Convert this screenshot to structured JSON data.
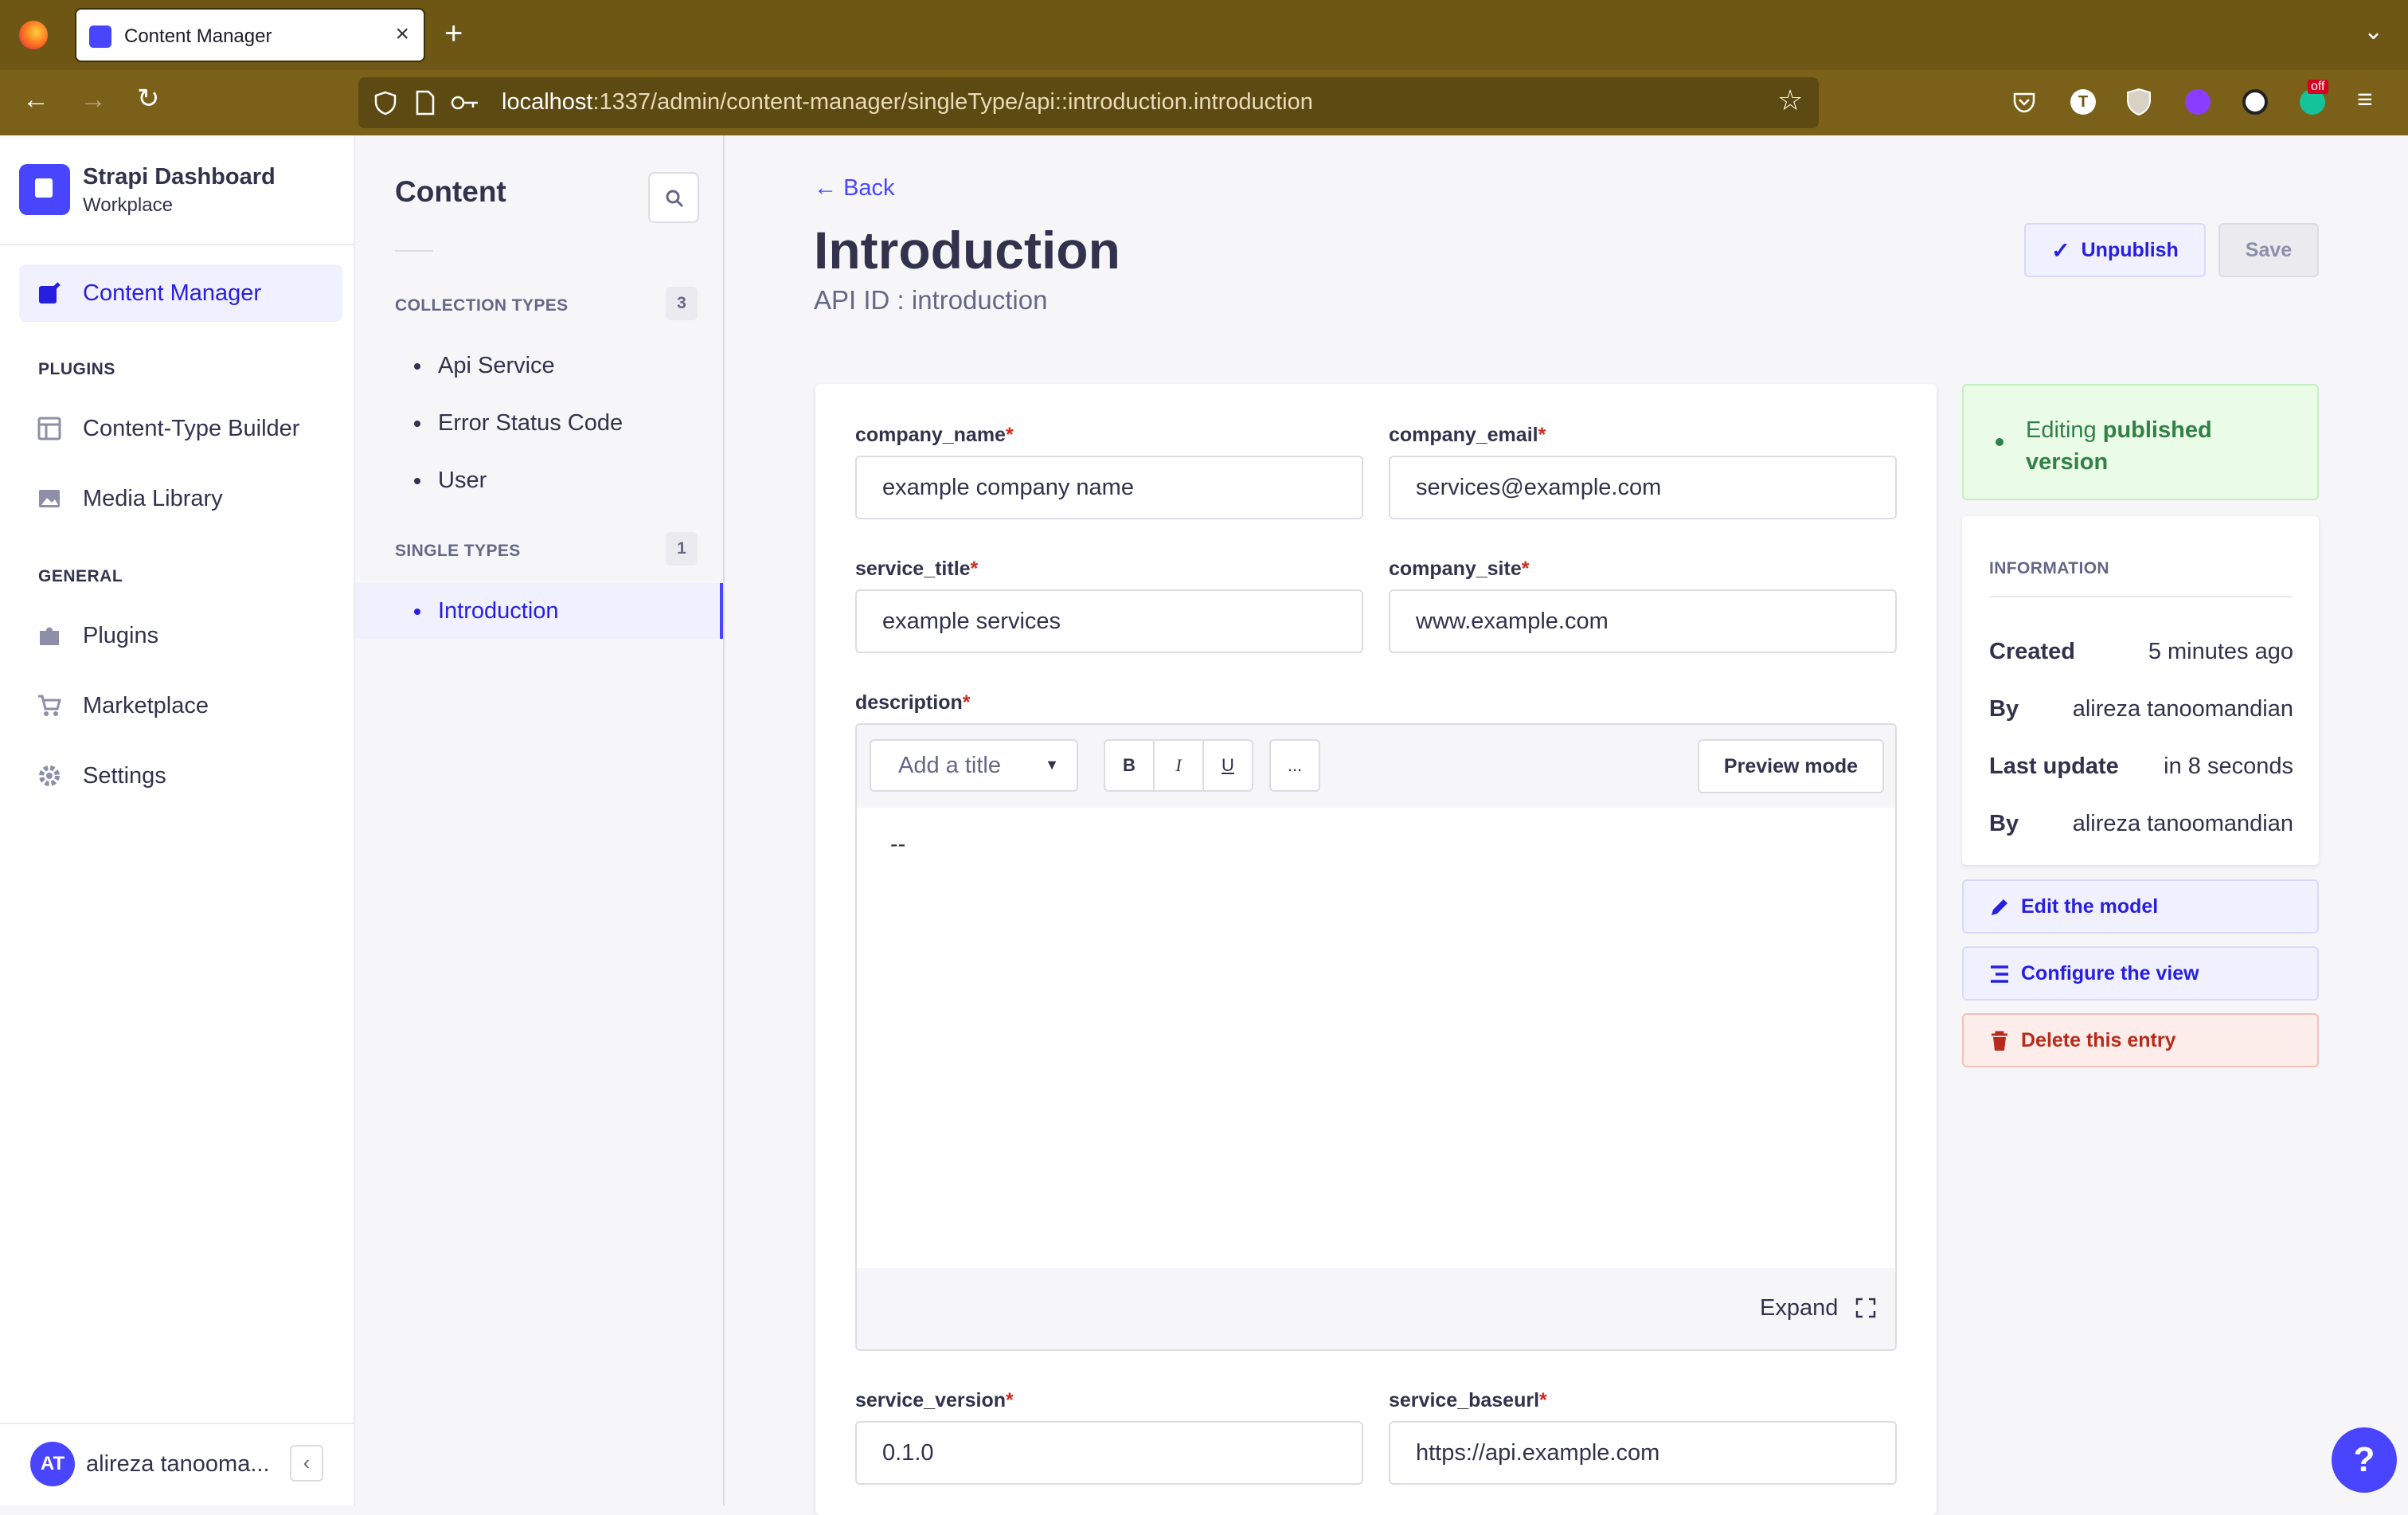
{
  "browser": {
    "tab_title": "Content Manager",
    "url_host": "localhost",
    "url_path": ":1337/admin/content-manager/singleType/api::introduction.introduction",
    "ext_badge": "off",
    "ext_t": "T"
  },
  "sidebar": {
    "brand_title": "Strapi Dashboard",
    "brand_subtitle": "Workplace",
    "content_manager": "Content Manager",
    "plugins_label": "PLUGINS",
    "content_type_builder": "Content-Type Builder",
    "media_library": "Media Library",
    "general_label": "GENERAL",
    "plugins": "Plugins",
    "marketplace": "Marketplace",
    "settings": "Settings",
    "avatar_initials": "AT",
    "user_name": "alireza tanooma..."
  },
  "subnav": {
    "title": "Content",
    "collection_label": "COLLECTION TYPES",
    "collection_count": "3",
    "collection_items": [
      "Api Service",
      "Error Status Code",
      "User"
    ],
    "single_label": "SINGLE TYPES",
    "single_count": "1",
    "single_items": [
      "Introduction"
    ]
  },
  "header": {
    "back": "Back",
    "title": "Introduction",
    "api_id": "API ID : introduction",
    "unpublish": "Unpublish",
    "save": "Save"
  },
  "form": {
    "company_name_label": "company_name",
    "company_name_value": "example company name",
    "company_email_label": "company_email",
    "company_email_value": "services@example.com",
    "service_title_label": "service_title",
    "service_title_value": "example services",
    "company_site_label": "company_site",
    "company_site_value": "www.example.com",
    "description_label": "description",
    "description_value": "--",
    "add_title": "Add a title",
    "bold": "B",
    "italic": "I",
    "underline": "U",
    "more": "...",
    "preview_mode": "Preview mode",
    "expand": "Expand",
    "service_version_label": "service_version",
    "service_version_value": "0.1.0",
    "service_baseurl_label": "service_baseurl",
    "service_baseurl_value": "https://api.example.com",
    "required_mark": "*"
  },
  "panel": {
    "editing_prefix": "Editing ",
    "editing_bold": "published version",
    "info_title": "INFORMATION",
    "created_label": "Created",
    "created_value": "5 minutes ago",
    "by_label": "By",
    "by_value": "alireza tanoomandian",
    "updated_label": "Last update",
    "updated_value": "in 8 seconds",
    "by2_label": "By",
    "by2_value": "alireza tanoomandian",
    "edit_model": "Edit the model",
    "configure_view": "Configure the view",
    "delete_entry": "Delete this entry"
  },
  "help": "?",
  "colors": {
    "primary": "#4945ff",
    "danger": "#d02b20",
    "success": "#328048",
    "chrome": "#6e5715"
  }
}
